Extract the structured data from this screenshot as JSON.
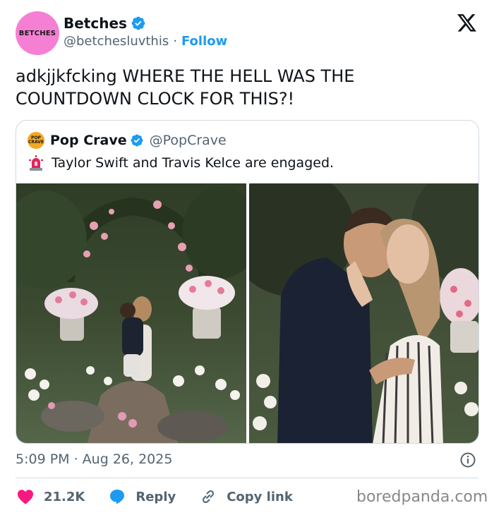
{
  "author": {
    "avatar_text": "BETCHES",
    "display_name": "Betches",
    "handle": "@betchesluvthis",
    "separator": "·",
    "follow_label": "Follow"
  },
  "tweet": {
    "text": "adkjjkfcking WHERE THE HELL WAS THE COUNTDOWN CLOCK FOR THIS?!"
  },
  "quote": {
    "avatar_text": "POP CRAVE",
    "display_name": "Pop Crave",
    "handle": "@PopCrave",
    "text": "Taylor Swift and Travis Kelce are engaged."
  },
  "meta": {
    "timestamp": "5:09 PM · Aug 26, 2025"
  },
  "actions": {
    "likes": "21.2K",
    "reply_label": "Reply",
    "copy_label": "Copy link"
  },
  "watermark": "boredpanda.com",
  "colors": {
    "accent": "#1d9bf0",
    "like": "#f91880",
    "avatar_bg": "#f57fd3"
  },
  "icons": [
    "verified-badge-icon",
    "x-logo-icon",
    "siren-icon",
    "info-icon",
    "heart-icon",
    "reply-bubble-icon",
    "link-icon"
  ]
}
